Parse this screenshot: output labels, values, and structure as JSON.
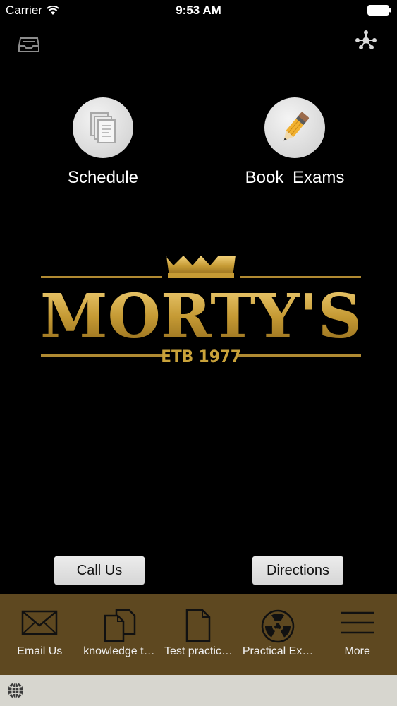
{
  "status_bar": {
    "carrier": "Carrier",
    "time": "9:53 AM"
  },
  "header": {
    "left_icon": "inbox-icon",
    "right_icon": "share-network-icon"
  },
  "actions": [
    {
      "label": "Schedule",
      "icon": "documents-icon"
    },
    {
      "label": "Book  Exams",
      "icon": "pencil-icon"
    }
  ],
  "logo": {
    "name": "MORTY'S",
    "tagline": "ETB 1977"
  },
  "buttons": {
    "call": "Call Us",
    "directions": "Directions"
  },
  "tabs": [
    {
      "label": "Email Us",
      "icon": "envelope-icon"
    },
    {
      "label": "knowledge t…",
      "icon": "documents-icon"
    },
    {
      "label": "Test practic…",
      "icon": "document-icon"
    },
    {
      "label": "Practical Ex…",
      "icon": "radiation-icon"
    },
    {
      "label": "More",
      "icon": "menu-icon"
    }
  ],
  "colors": {
    "tab_bar": "#5e4820",
    "gold": "#c9a23a",
    "background": "#000000"
  },
  "bottom_bar": {
    "icon": "globe-icon"
  }
}
